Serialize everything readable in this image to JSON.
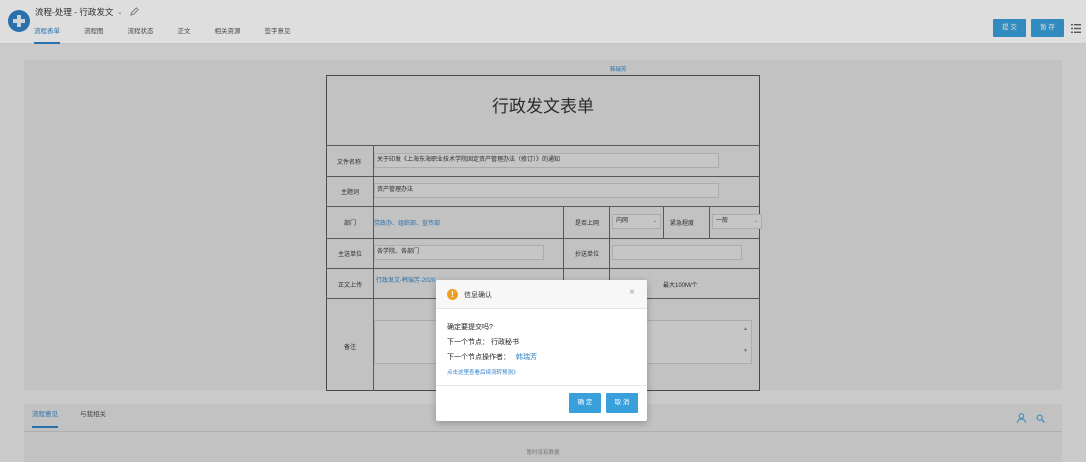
{
  "header": {
    "title": "流程-处理 - 行政发文",
    "title_chevron": "⌄",
    "tabs": [
      "流程表单",
      "流程图",
      "流程状态",
      "正文",
      "相关资源",
      "签字意见"
    ],
    "submit_label": "提 交",
    "save_label": "暂 存"
  },
  "form": {
    "author_top": "韩瑞芳",
    "title": "行政发文表单",
    "doc_name_label": "文件名称",
    "doc_name_value": "关于印发《上海东海职业技术学院固定资产管理办法（修订）》的通知",
    "subject_label": "主题词",
    "subject_value": "资产管理办法",
    "dept_label": "部门",
    "dept_value": "党政办、组织部、宣传部",
    "internet_label": "是否上网",
    "internet_value": "内网",
    "urgency_label": "紧急程度",
    "urgency_value": "一般",
    "main_unit_label": "主送单位",
    "main_unit_value": "各学院、各部门",
    "cc_unit_label": "抄送单位",
    "cc_unit_value": "",
    "body_upload_label": "正文上传",
    "body_upload_value": "行政发文-韩瑞芳-2020",
    "size_note": "最大100M/个",
    "remark_label": "备注"
  },
  "bottom": {
    "tabs": [
      "流程意见",
      "与我相关"
    ],
    "empty_text": "暂时没有数据"
  },
  "modal": {
    "title": "信息确认",
    "question": "确定要提交吗?",
    "next_node_label": "下一个节点：",
    "next_node_value": "行政秘书",
    "next_operator_label": "下一个节点操作者：",
    "next_operator_value": "韩瑞芳",
    "preview_link": "点击这里查看后续流转预测》",
    "confirm_label": "确 定",
    "cancel_label": "取 消"
  },
  "colors": {
    "accent": "#2f82c6",
    "button": "#3aa0dc",
    "warning": "#f0a020"
  }
}
